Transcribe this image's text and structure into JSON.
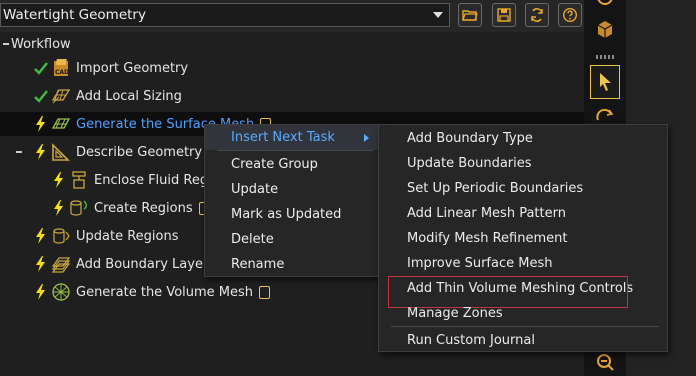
{
  "workflow_select": {
    "value": "Watertight Geometry"
  },
  "toolbar": [
    {
      "name": "open-folder-icon",
      "color": "#e8a72a"
    },
    {
      "name": "save-icon",
      "color": "#e8a72a"
    },
    {
      "name": "refresh-icon",
      "color": "#e8a72a"
    },
    {
      "name": "help-icon",
      "color": "#e8a72a"
    }
  ],
  "tree": {
    "root_label": "Workflow",
    "items": [
      {
        "label": "Import Geometry",
        "state": "done"
      },
      {
        "label": "Add Local Sizing",
        "state": "done"
      },
      {
        "label": "Generate the Surface Mesh",
        "state": "pending"
      },
      {
        "label": "Describe Geometry",
        "state": "pending"
      },
      {
        "label": "Enclose Fluid Regio",
        "state": "pending"
      },
      {
        "label": "Create Regions",
        "state": "pending"
      },
      {
        "label": "Update Regions",
        "state": "pending"
      },
      {
        "label": "Add Boundary Layers",
        "state": "pending"
      },
      {
        "label": "Generate the Volume Mesh",
        "state": "pending"
      }
    ]
  },
  "context_menu": {
    "items": [
      "Insert Next Task",
      "Create Group",
      "Update",
      "Mark as Updated",
      "Delete",
      "Rename"
    ]
  },
  "submenu": {
    "items": [
      "Add Boundary Type",
      "Update Boundaries",
      "Set Up Periodic Boundaries",
      "Add Linear Mesh Pattern",
      "Modify Mesh Refinement",
      "Improve Surface Mesh",
      "Add Thin Volume Meshing Controls",
      "Manage Zones",
      "Run Custom Journal"
    ]
  },
  "colors": {
    "check": "#3fbf3f",
    "lightning": "#f5e400",
    "selected_text": "#4ea1ff",
    "highlight_box": "#c0353b"
  }
}
